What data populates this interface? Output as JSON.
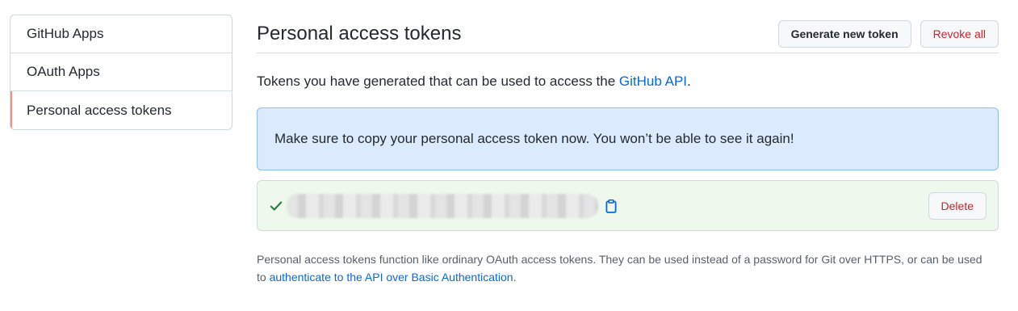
{
  "sidebar": {
    "items": [
      {
        "label": "GitHub Apps"
      },
      {
        "label": "OAuth Apps"
      },
      {
        "label": "Personal access tokens"
      }
    ]
  },
  "header": {
    "title": "Personal access tokens",
    "generate_label": "Generate new token",
    "revoke_label": "Revoke all"
  },
  "description": {
    "text": "Tokens you have generated that can be used to access the ",
    "link": "GitHub API",
    "suffix": "."
  },
  "flash": {
    "message": "Make sure to copy your personal access token now. You won’t be able to see it again!"
  },
  "token": {
    "check_icon": "check-icon",
    "copy_icon": "clipboard-icon",
    "delete_label": "Delete"
  },
  "footnote": {
    "text": "Personal access tokens function like ordinary OAuth access tokens. They can be used instead of a password for Git over HTTPS, or can be used to ",
    "link": "authenticate to the API over Basic Authentication",
    "suffix": "."
  },
  "colors": {
    "accent_link": "#0969da",
    "danger": "#cf222e",
    "selected_marker": "#fd8c73",
    "flash_bg": "#dbebfd",
    "success_row_bg": "#eef8ec"
  }
}
